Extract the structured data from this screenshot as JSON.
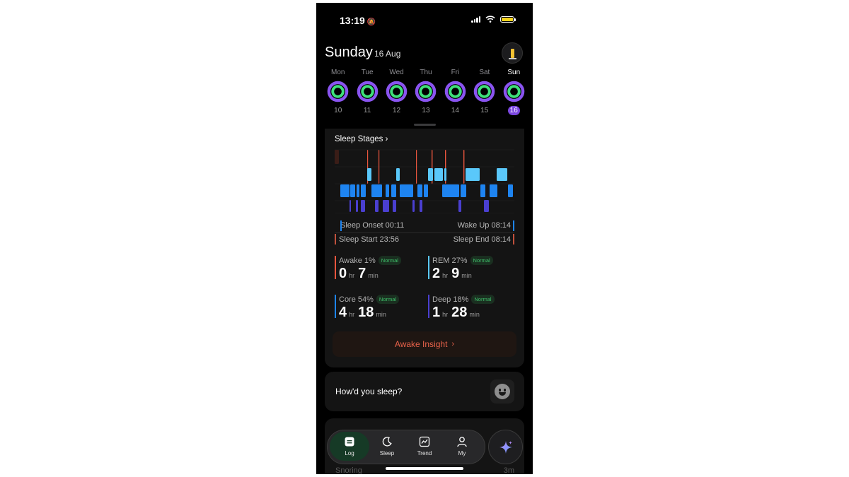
{
  "status_bar": {
    "time": "13:19"
  },
  "header": {
    "day": "Sunday",
    "date": "16 Aug"
  },
  "week": [
    {
      "label": "Mon",
      "num": "10",
      "active": false
    },
    {
      "label": "Tue",
      "num": "11",
      "active": false
    },
    {
      "label": "Wed",
      "num": "12",
      "active": false
    },
    {
      "label": "Thu",
      "num": "13",
      "active": false
    },
    {
      "label": "Fri",
      "num": "14",
      "active": false
    },
    {
      "label": "Sat",
      "num": "15",
      "active": false
    },
    {
      "label": "Sun",
      "num": "16",
      "active": true
    }
  ],
  "sleep_stages": {
    "title": "Sleep Stages",
    "sleep_onset": "Sleep Onset 00:11",
    "wake_up": "Wake Up 08:14",
    "sleep_start": "Sleep Start 23:56",
    "sleep_end": "Sleep End 08:14",
    "colors": {
      "awake": "#e8553e",
      "rem": "#5ac8fa",
      "core": "#1e84f0",
      "deep": "#4a3fd0"
    }
  },
  "metrics": {
    "awake": {
      "label": "Awake 1%",
      "badge": "Normal",
      "hr": "0",
      "hr_unit": "hr",
      "min": "7",
      "min_unit": "min"
    },
    "rem": {
      "label": "REM 27%",
      "badge": "Normal",
      "hr": "2",
      "hr_unit": "hr",
      "min": "9",
      "min_unit": "min"
    },
    "core": {
      "label": "Core 54%",
      "badge": "Normal",
      "hr": "4",
      "hr_unit": "hr",
      "min": "18",
      "min_unit": "min"
    },
    "deep": {
      "label": "Deep 18%",
      "badge": "Normal",
      "hr": "1",
      "hr_unit": "hr",
      "min": "28",
      "min_unit": "min"
    }
  },
  "insight": {
    "label": "Awake Insight"
  },
  "feedback": {
    "question": "How'd you sleep?"
  },
  "snoring": {
    "label": "Snoring",
    "value": "3m"
  },
  "tabs": [
    {
      "label": "Log",
      "icon": "log-icon",
      "active": true
    },
    {
      "label": "Sleep",
      "icon": "moon-icon",
      "active": false
    },
    {
      "label": "Trend",
      "icon": "trend-icon",
      "active": false
    },
    {
      "label": "My",
      "icon": "person-icon",
      "active": false
    }
  ]
}
